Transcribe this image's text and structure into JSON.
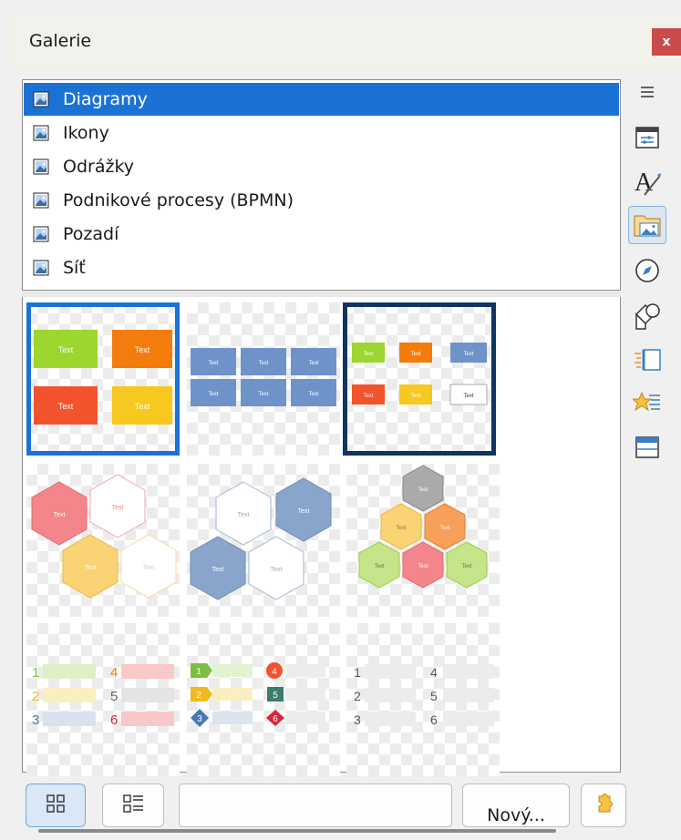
{
  "panel": {
    "title": "Galerie",
    "close_label": "x"
  },
  "categories": [
    {
      "label": "Diagramy",
      "selected": true
    },
    {
      "label": "Ikony",
      "selected": false
    },
    {
      "label": "Odrážky",
      "selected": false
    },
    {
      "label": "Podnikové procesy (BPMN)",
      "selected": false
    },
    {
      "label": "Pozadí",
      "selected": false
    },
    {
      "label": "Síť",
      "selected": false
    }
  ],
  "thumbnails": {
    "t1": {
      "labels": [
        "Text",
        "Text",
        "Text",
        "Text"
      ]
    },
    "t2": {
      "labels": [
        "Text",
        "Text",
        "Text",
        "Text",
        "Text",
        "Text"
      ]
    },
    "t3": {
      "labels": [
        "Text",
        "Text",
        "Text",
        "Text",
        "Text",
        "Text"
      ]
    },
    "t4": {
      "labels": [
        "Text",
        "Text",
        "Text",
        "Text"
      ]
    },
    "t5": {
      "labels": [
        "Text",
        "Text",
        "Text",
        "Text"
      ]
    },
    "t6": {
      "labels": [
        "Text",
        "Text",
        "Text",
        "Text",
        "Text",
        "Text"
      ]
    },
    "t7": {
      "numbers": [
        "1",
        "2",
        "3",
        "4",
        "5",
        "6"
      ]
    },
    "t8": {
      "numbers": [
        "1",
        "2",
        "3",
        "4",
        "5",
        "6"
      ]
    },
    "t9": {
      "numbers": [
        "1",
        "2",
        "3",
        "4",
        "5",
        "6"
      ]
    }
  },
  "bottom": {
    "new_label": "Nový..."
  },
  "sidebar": {
    "icons": [
      "hamburger-menu-icon",
      "properties-icon",
      "styles-icon",
      "gallery-icon",
      "navigator-icon",
      "shapes-icon",
      "animation-icon",
      "effects-icon",
      "master-slides-icon"
    ],
    "active": "gallery-icon"
  },
  "colors": {
    "selection": "#1a73d4",
    "selection_dark": "#0f3560",
    "close": "#c94b4b"
  }
}
